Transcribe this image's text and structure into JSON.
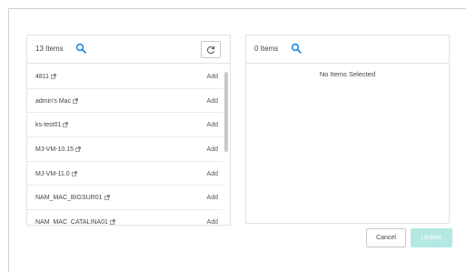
{
  "available": {
    "count_label": "13 Items",
    "items": [
      {
        "name": "4811",
        "action": "Add"
      },
      {
        "name": "admin's Mac",
        "action": "Add"
      },
      {
        "name": "ks-test01",
        "action": "Add"
      },
      {
        "name": "MJ-VM-10.15",
        "action": "Add"
      },
      {
        "name": "MJ-VM-11.0",
        "action": "Add"
      },
      {
        "name": "NAM_MAC_BIGSUR01",
        "action": "Add"
      },
      {
        "name": "NAM_MAC_CATALINA01",
        "action": "Add"
      }
    ]
  },
  "selected": {
    "count_label": "0 Items",
    "empty_text": "No Items Selected"
  },
  "footer": {
    "cancel_label": "Cancel",
    "update_label": "Update"
  },
  "colors": {
    "accent": "#1e88e5",
    "update_disabled": "#b4e8e2"
  },
  "icons": {
    "search": "search-icon",
    "refresh": "refresh-icon",
    "external_link": "external-link-icon"
  }
}
